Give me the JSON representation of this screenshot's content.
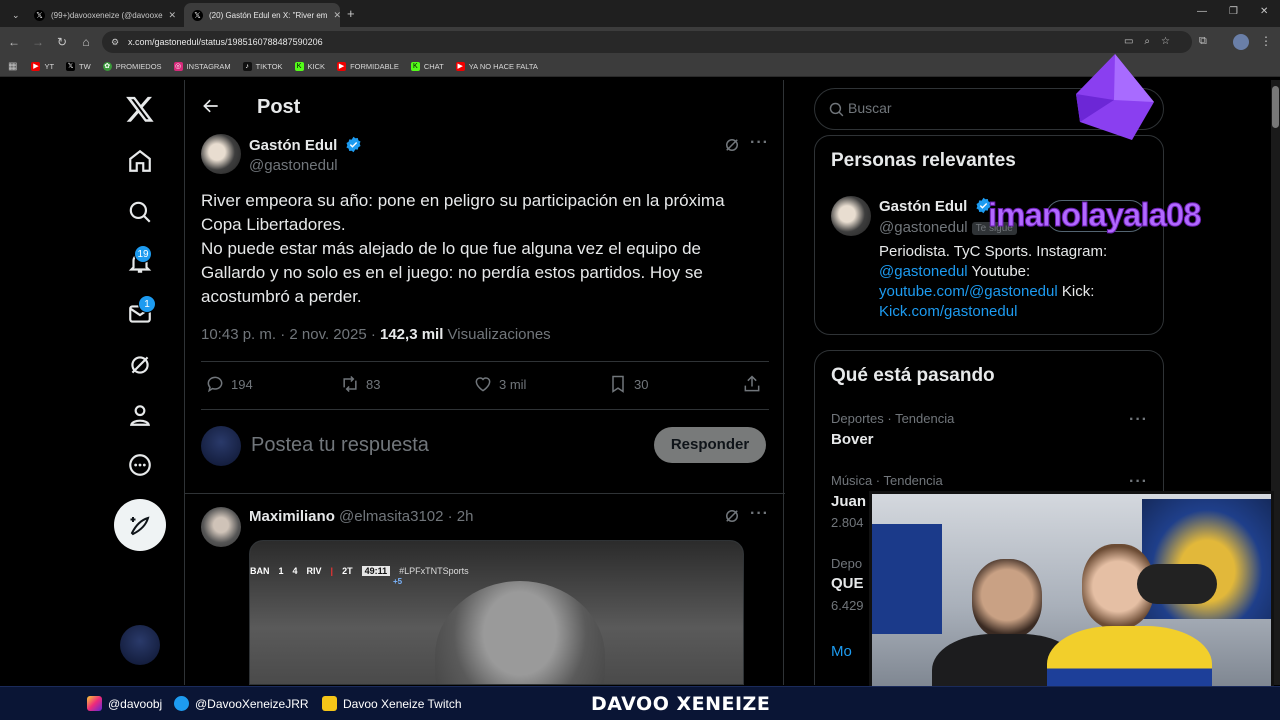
{
  "browser": {
    "tabs": [
      {
        "title": "(99+)davooxeneize (@davooxe",
        "active": false
      },
      {
        "title": "(20) Gastón Edul en X: \"River em",
        "active": true
      }
    ],
    "url": "x.com/gastonedul/status/1985160788487590206",
    "bookmarks": [
      "YT",
      "TW",
      "PROMIEDOS",
      "INSTAGRAM",
      "TIKTOK",
      "KICK",
      "FORMIDABLE",
      "CHAT",
      "YA NO HACE FALTA"
    ]
  },
  "nav": {
    "notifications_badge": "19",
    "messages_badge": "1"
  },
  "post": {
    "header_title": "Post",
    "author_name": "Gastón Edul",
    "author_handle": "@gastonedul",
    "text_line1": "River empeora su año: pone en peligro su participación en la próxima",
    "text_line2": "Copa Libertadores.",
    "text_line3": "No puede estar más alejado de lo que fue alguna vez el equipo de",
    "text_line4": "Gallardo y no solo es en el juego: no perdía estos partidos. Hoy se",
    "text_line5": "acostumbró a perder.",
    "time": "10:43 p. m. · 2 nov. 2025 · ",
    "views_count": "142,3 mil",
    "views_label": " Visualizaciones",
    "replies": "194",
    "reposts": "83",
    "likes": "3 mil",
    "bookmarks": "30"
  },
  "reply_box": {
    "placeholder": "Postea tu respuesta",
    "button": "Responder"
  },
  "reply": {
    "name": "Maximiliano",
    "handle_time": " @elmasita3102 · 2h",
    "score": {
      "home": "BAN",
      "home_goals": "1",
      "away_goals": "4",
      "away": "RIV",
      "period": "2T",
      "clock": "49:11",
      "added": "+5",
      "hashtag": "#LPFxTNTSports"
    }
  },
  "sidebar": {
    "search_placeholder": "Buscar",
    "relevant_title": "Personas relevantes",
    "relevant_name": "Gastón Edul",
    "relevant_handle": "@gastonedul",
    "follows_tag": "Te sigue",
    "bio_text": "Periodista. TyC Sports. Instagram:",
    "bio_link1": "@gastonedul",
    "bio_mid": " Youtube:",
    "bio_link2": "youtube.com/@gastonedul",
    "bio_mid2": " Kick:",
    "bio_link3": "Kick.com/gastonedul",
    "trends_title": "Qué está pasando",
    "trends": [
      {
        "category": "Deportes · Tendencia",
        "name": "Bover",
        "count": ""
      },
      {
        "category": "Música · Tendencia",
        "name": "Juan",
        "count": "2.804"
      },
      {
        "category": "Depo",
        "name": "QUE",
        "count": "6.429"
      }
    ],
    "show_more": "Mo"
  },
  "overlay": {
    "watermark": "imanolayala08",
    "stream_instagram": "@davoobj",
    "stream_twitter": "@DavooXeneizeJRR",
    "stream_twitch": "Davoo Xeneize Twitch",
    "stream_brand": "DAVOO XENEIZE"
  },
  "colors": {
    "accent": "#1d9bf0",
    "background": "#000000",
    "muted": "#71767b",
    "watermark": "#b168ff"
  }
}
